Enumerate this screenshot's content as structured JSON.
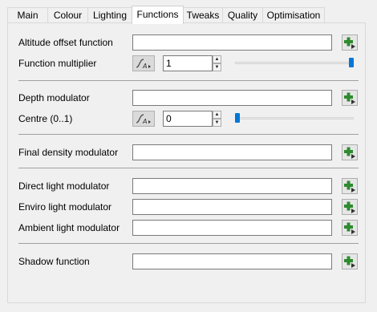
{
  "tabs": [
    {
      "label": "Main",
      "active": false
    },
    {
      "label": "Colour",
      "active": false
    },
    {
      "label": "Lighting",
      "active": false
    },
    {
      "label": "Functions",
      "active": true
    },
    {
      "label": "Tweaks",
      "active": false
    },
    {
      "label": "Quality",
      "active": false
    },
    {
      "label": "Optimisation",
      "active": false
    }
  ],
  "functions": {
    "altitude_offset": {
      "label": "Altitude offset function",
      "value": ""
    },
    "function_multiplier": {
      "label": "Function multiplier",
      "value": "1",
      "slider_fraction": 1.0
    },
    "depth_modulator": {
      "label": "Depth modulator",
      "value": ""
    },
    "centre": {
      "label": "Centre (0..1)",
      "value": "0",
      "slider_fraction": 0.0
    },
    "final_density_modulator": {
      "label": "Final density modulator",
      "value": ""
    },
    "direct_light_modulator": {
      "label": "Direct light modulator",
      "value": ""
    },
    "enviro_light_modulator": {
      "label": "Enviro light modulator",
      "value": ""
    },
    "ambient_light_modulator": {
      "label": "Ambient light modulator",
      "value": ""
    },
    "shadow_function": {
      "label": "Shadow function",
      "value": ""
    }
  },
  "icons": {
    "add": "add-plus-icon",
    "curve": "function-curve-icon",
    "spin_up": "spin-up-arrow-icon",
    "spin_down": "spin-down-arrow-icon"
  },
  "colors": {
    "accent": "#0078d7",
    "add_icon": "#2e8b2e"
  }
}
